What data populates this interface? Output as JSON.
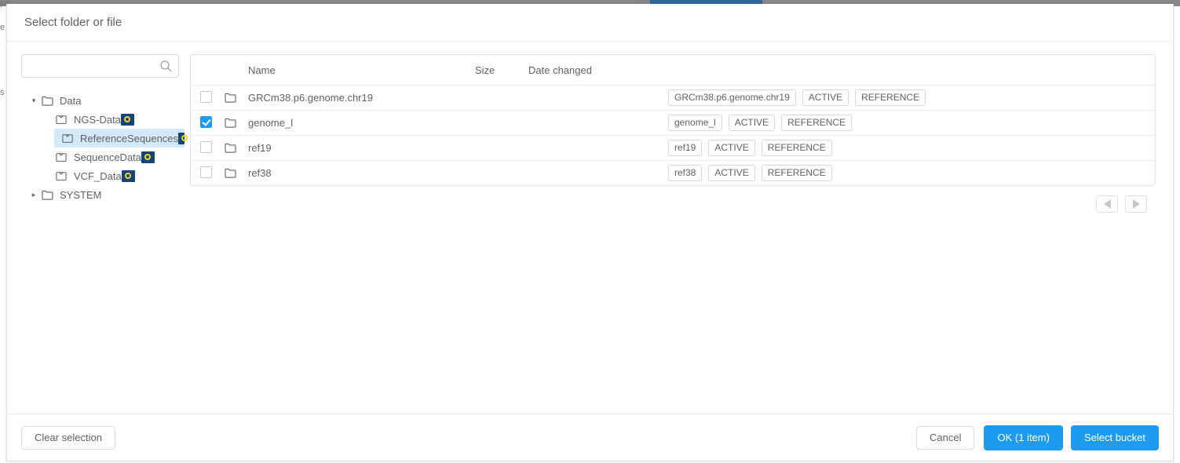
{
  "background": {
    "ghost_lines": [
      "PS",
      "e",
      "s"
    ],
    "accent_color": "#336699",
    "bar_color": "#878787"
  },
  "dialog": {
    "title": "Select folder or file"
  },
  "search": {
    "value": "",
    "placeholder": "",
    "icon": "search-icon"
  },
  "tree": {
    "nodes": [
      {
        "label": "Data",
        "icon": "folder-icon",
        "expanded": true,
        "caret": "▾",
        "badge": false,
        "selected": false,
        "children": [
          {
            "label": "NGS-Data",
            "icon": "bucket-icon",
            "badge": true,
            "selected": false
          },
          {
            "label": "ReferenceSequences",
            "icon": "bucket-icon",
            "badge": true,
            "selected": true
          },
          {
            "label": "SequenceData",
            "icon": "bucket-icon",
            "badge": true,
            "selected": false
          },
          {
            "label": "VCF_Data",
            "icon": "bucket-icon",
            "badge": true,
            "selected": false
          }
        ]
      },
      {
        "label": "SYSTEM",
        "icon": "folder-icon",
        "expanded": false,
        "caret": "▸",
        "badge": false,
        "selected": false,
        "children": []
      }
    ]
  },
  "table": {
    "columns": {
      "name": "Name",
      "size": "Size",
      "date": "Date changed"
    },
    "rows": [
      {
        "name": "GRCm38.p6.genome.chr19",
        "checked": false,
        "size": "",
        "date": "",
        "tags": [
          "GRCm38.p6.genome.chr19",
          "ACTIVE",
          "REFERENCE"
        ]
      },
      {
        "name": "genome_l",
        "checked": true,
        "size": "",
        "date": "",
        "tags": [
          "genome_l",
          "ACTIVE",
          "REFERENCE"
        ]
      },
      {
        "name": "ref19",
        "checked": false,
        "size": "",
        "date": "",
        "tags": [
          "ref19",
          "ACTIVE",
          "REFERENCE"
        ]
      },
      {
        "name": "ref38",
        "checked": false,
        "size": "",
        "date": "",
        "tags": [
          "ref38",
          "ACTIVE",
          "REFERENCE"
        ]
      }
    ]
  },
  "pagination": {
    "prev_icon": "triangle-left-icon",
    "next_icon": "triangle-right-icon"
  },
  "footer": {
    "clear_selection": "Clear selection",
    "cancel": "Cancel",
    "ok": "OK (1 item)",
    "select_bucket": "Select bucket"
  },
  "colors": {
    "primary": "#1d9bf0",
    "selected_row": "#d4e9f7",
    "badge_bg": "#14457a",
    "badge_ring": "#f5d521",
    "text": "#5e6266"
  }
}
